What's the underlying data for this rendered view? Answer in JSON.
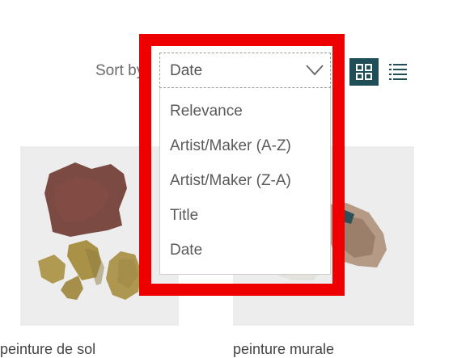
{
  "sort": {
    "label": "Sort by",
    "selected": "Date",
    "options": [
      "Relevance",
      "Artist/Maker (A-Z)",
      "Artist/Maker (Z-A)",
      "Title",
      "Date"
    ]
  },
  "view": {
    "active": "grid",
    "accent_color": "#1f4e59"
  },
  "results": [
    {
      "title": "peinture de sol"
    },
    {
      "title": "peinture murale"
    }
  ],
  "highlight_color": "#ee0000"
}
